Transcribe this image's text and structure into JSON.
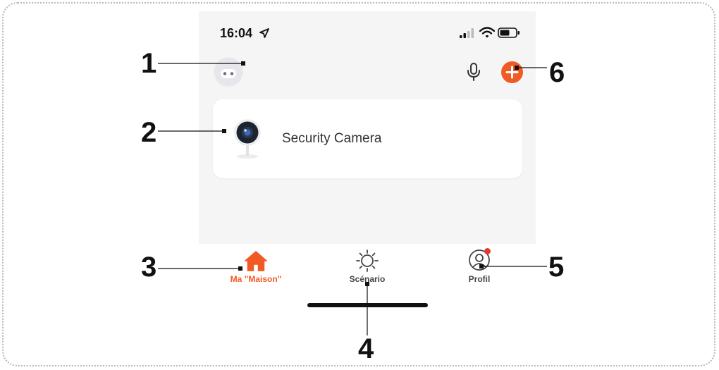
{
  "status_bar": {
    "time": "16:04"
  },
  "header": {
    "avatar_icon": "robot-avatar-icon",
    "mic_icon": "microphone-icon",
    "add_icon": "plus-icon"
  },
  "devices": [
    {
      "name": "Security Camera",
      "icon": "security-camera-icon"
    }
  ],
  "tabs": [
    {
      "label": "Ma \"Maison\"",
      "icon": "home-icon",
      "active": true
    },
    {
      "label": "Scénario",
      "icon": "sun-icon",
      "active": false
    },
    {
      "label": "Profil",
      "icon": "profile-icon",
      "active": false,
      "badge": true
    }
  ],
  "callouts": [
    "1",
    "2",
    "3",
    "4",
    "5",
    "6"
  ],
  "colors": {
    "accent": "#f15a24",
    "inactive": "#444444",
    "badge": "#e53935",
    "background": "#f5f5f5"
  }
}
